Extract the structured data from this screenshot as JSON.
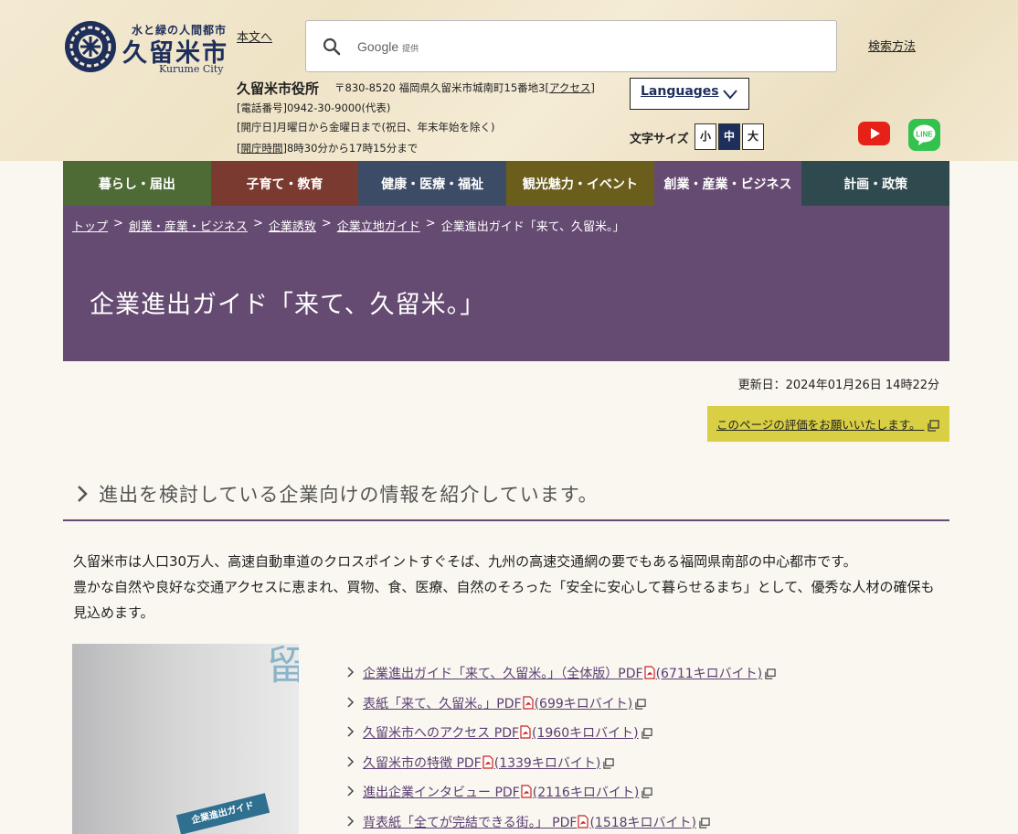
{
  "header": {
    "logo_sub": "水と緑の人間都市",
    "logo_main": "久留米市",
    "logo_en": "Kurume City",
    "skip_link": "本文へ",
    "search_google": "Google",
    "search_provided": "提供",
    "search_help": "検索方法",
    "office_name": "久留米市役所",
    "office_address": "〒830-8520 福岡県久留米市城南町15番地3",
    "office_access": "[アクセス]",
    "phone_label": "[電話番号]",
    "phone_value": "0942-30-9000(代表)",
    "days_label": "[開庁日]",
    "days_value": "月曜日から金曜日まで(祝日、年末年始を除く)",
    "hours_label": "[開庁時間]",
    "hours_value": "8時30分から17時15分まで",
    "languages": "Languages",
    "font_size_label": "文字サイズ",
    "font_sizes": [
      "小",
      "中",
      "大"
    ],
    "font_size_active": "中"
  },
  "nav": [
    {
      "label": "暮らし・届出",
      "color": "#4f6b35"
    },
    {
      "label": "子育て・教育",
      "color": "#7a3a30"
    },
    {
      "label": "健康・医療・福祉",
      "color": "#3d4c66"
    },
    {
      "label": "観光魅力・イベント",
      "color": "#6b5e1c"
    },
    {
      "label": "創業・産業・ビジネス",
      "color": "#654a71"
    },
    {
      "label": "計画・政策",
      "color": "#2f4a4f"
    }
  ],
  "breadcrumb": [
    {
      "label": "トップ",
      "link": true
    },
    {
      "label": "創業・産業・ビジネス",
      "link": true
    },
    {
      "label": "企業誘致",
      "link": true
    },
    {
      "label": "企業立地ガイド",
      "link": true
    },
    {
      "label": "企業進出ガイド「来て、久留米。」",
      "link": false
    }
  ],
  "page_title": "企業進出ガイド「来て、久留米。」",
  "updated": "更新日：2024年01月26日 14時22分",
  "rate_button": "このページの評価をお願いいたします。",
  "section_heading": "進出を検討している企業向けの情報を紹介しています。",
  "body_paragraph_1": "久留米市は人口30万人、高速自動車道のクロスポイントすぐそば、九州の高速交通網の要でもある福岡県南部の中心都市です。",
  "body_paragraph_2": "豊かな自然や良好な交通アクセスに恵まれ、買物、食、医療、自然のそろった「安全に安心して暮らせるまち」として、優秀な人材の確保も見込めます。",
  "cover": {
    "vertical_text": "来て、久留",
    "tag": "企業進出ガイド"
  },
  "downloads": [
    {
      "title": "企業進出ガイド「来て、久留米。」（全体版）PDF",
      "size": "(6711キロバイト)"
    },
    {
      "title": "表紙「来て、久留米。」PDF",
      "size": "(699キロバイト)"
    },
    {
      "title": "久留米市へのアクセス PDF",
      "size": "(1960キロバイト)"
    },
    {
      "title": "久留米市の特徴 PDF",
      "size": "(1339キロバイト)"
    },
    {
      "title": "進出企業インタビュー PDF",
      "size": "(2116キロバイト)"
    },
    {
      "title": "背表紙「全てが完結できる街。」 PDF",
      "size": "(1518キロバイト)"
    }
  ],
  "colors": {
    "brand_navy": "#1f2f5c",
    "title_band": "#654a71",
    "rate_button": "#d8cf44"
  }
}
